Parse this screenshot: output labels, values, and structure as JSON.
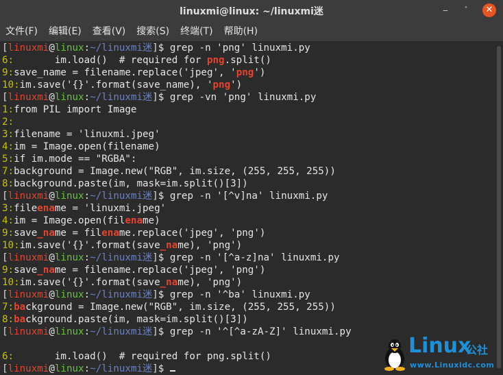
{
  "window": {
    "title": "linuxmi@linux: ~/linuxmi迷"
  },
  "menu": [
    "文件(F)",
    "编辑(E)",
    "查看(V)",
    "搜索(S)",
    "终端(T)",
    "帮助(H)"
  ],
  "prompt": {
    "user": "linuxmi",
    "host": "linux",
    "path": "~/linuxmi迷"
  },
  "lines": [
    {
      "type": "prompt",
      "cmd": "$ grep -n 'png' linuxmi.py"
    },
    {
      "type": "out",
      "segs": [
        {
          "c": "ln",
          "t": "6:"
        },
        {
          "t": "       im.load()  # required for "
        },
        {
          "c": "m",
          "t": "png"
        },
        {
          "t": ".split()"
        }
      ]
    },
    {
      "type": "out",
      "segs": [
        {
          "c": "ln",
          "t": "9:"
        },
        {
          "t": "save_name = filename.replace('jpeg', '"
        },
        {
          "c": "m",
          "t": "png"
        },
        {
          "t": "')"
        }
      ]
    },
    {
      "type": "out",
      "segs": [
        {
          "c": "ln",
          "t": "10:"
        },
        {
          "t": "im.save('{}'.format(save_name), '"
        },
        {
          "c": "m",
          "t": "png"
        },
        {
          "t": "')"
        }
      ]
    },
    {
      "type": "prompt",
      "cmd": "$ grep -vn 'png' linuxmi.py"
    },
    {
      "type": "out",
      "segs": [
        {
          "c": "ln",
          "t": "1:"
        },
        {
          "t": "from PIL import Image"
        }
      ]
    },
    {
      "type": "out",
      "segs": [
        {
          "c": "ln",
          "t": "2:"
        }
      ]
    },
    {
      "type": "out",
      "segs": [
        {
          "c": "ln",
          "t": "3:"
        },
        {
          "t": "filename = 'linuxmi.jpeg'"
        }
      ]
    },
    {
      "type": "out",
      "segs": [
        {
          "c": "ln",
          "t": "4:"
        },
        {
          "t": "im = Image.open(filename)"
        }
      ]
    },
    {
      "type": "out",
      "segs": [
        {
          "c": "ln",
          "t": "5:"
        },
        {
          "t": "if im.mode == \"RGBA\":"
        }
      ]
    },
    {
      "type": "out",
      "segs": [
        {
          "c": "ln",
          "t": "7:"
        },
        {
          "t": "background = Image.new(\"RGB\", im.size, (255, 255, 255))"
        }
      ]
    },
    {
      "type": "out",
      "segs": [
        {
          "c": "ln",
          "t": "8:"
        },
        {
          "t": "background.paste(im, mask=im.split()[3])"
        }
      ]
    },
    {
      "type": "prompt",
      "cmd": "$ grep -n '[^v]na' linuxmi.py"
    },
    {
      "type": "out",
      "segs": [
        {
          "c": "ln",
          "t": "3:"
        },
        {
          "t": "file"
        },
        {
          "c": "m",
          "t": "ena"
        },
        {
          "t": "me = 'linuxmi.jpeg'"
        }
      ]
    },
    {
      "type": "out",
      "segs": [
        {
          "c": "ln",
          "t": "4:"
        },
        {
          "t": "im = Image.open(fil"
        },
        {
          "c": "m",
          "t": "ena"
        },
        {
          "t": "me)"
        }
      ]
    },
    {
      "type": "out",
      "segs": [
        {
          "c": "ln",
          "t": "9:"
        },
        {
          "t": "save"
        },
        {
          "c": "m",
          "t": "_na"
        },
        {
          "t": "me = fil"
        },
        {
          "c": "m",
          "t": "ena"
        },
        {
          "t": "me.replace('jpeg', 'png')"
        }
      ]
    },
    {
      "type": "out",
      "segs": [
        {
          "c": "ln",
          "t": "10:"
        },
        {
          "t": "im.save('{}'.format(save"
        },
        {
          "c": "m",
          "t": "_na"
        },
        {
          "t": "me), 'png')"
        }
      ]
    },
    {
      "type": "prompt",
      "cmd": "$ grep -n '[^a-z]na' linuxmi.py"
    },
    {
      "type": "out",
      "segs": [
        {
          "c": "ln",
          "t": "9:"
        },
        {
          "t": "save"
        },
        {
          "c": "m",
          "t": "_na"
        },
        {
          "t": "me = filename.replace('jpeg', 'png')"
        }
      ]
    },
    {
      "type": "out",
      "segs": [
        {
          "c": "ln",
          "t": "10:"
        },
        {
          "t": "im.save('{}'.format(save"
        },
        {
          "c": "m",
          "t": "_na"
        },
        {
          "t": "me), 'png')"
        }
      ]
    },
    {
      "type": "prompt",
      "cmd": "$ grep -n '^ba' linuxmi.py"
    },
    {
      "type": "out",
      "segs": [
        {
          "c": "ln",
          "t": "7:"
        },
        {
          "c": "m",
          "t": "ba"
        },
        {
          "t": "ckground = Image.new(\"RGB\", im.size, (255, 255, 255))"
        }
      ]
    },
    {
      "type": "out",
      "segs": [
        {
          "c": "ln",
          "t": "8:"
        },
        {
          "c": "m",
          "t": "ba"
        },
        {
          "t": "ckground.paste(im, mask=im.split()[3])"
        }
      ]
    },
    {
      "type": "prompt",
      "cmd": "$ grep -n '^[^a-zA-Z]' linuxmi.py"
    },
    {
      "type": "out",
      "segs": []
    },
    {
      "type": "out",
      "segs": [
        {
          "c": "ln",
          "t": "6:"
        },
        {
          "t": "       im.load()  # required for png.split()"
        }
      ]
    },
    {
      "type": "prompt",
      "cmd": "$ ",
      "cursor": true
    }
  ],
  "watermark": {
    "brand": "Linux",
    "cn": "公社",
    "url": "www.Linuxidc.com"
  }
}
